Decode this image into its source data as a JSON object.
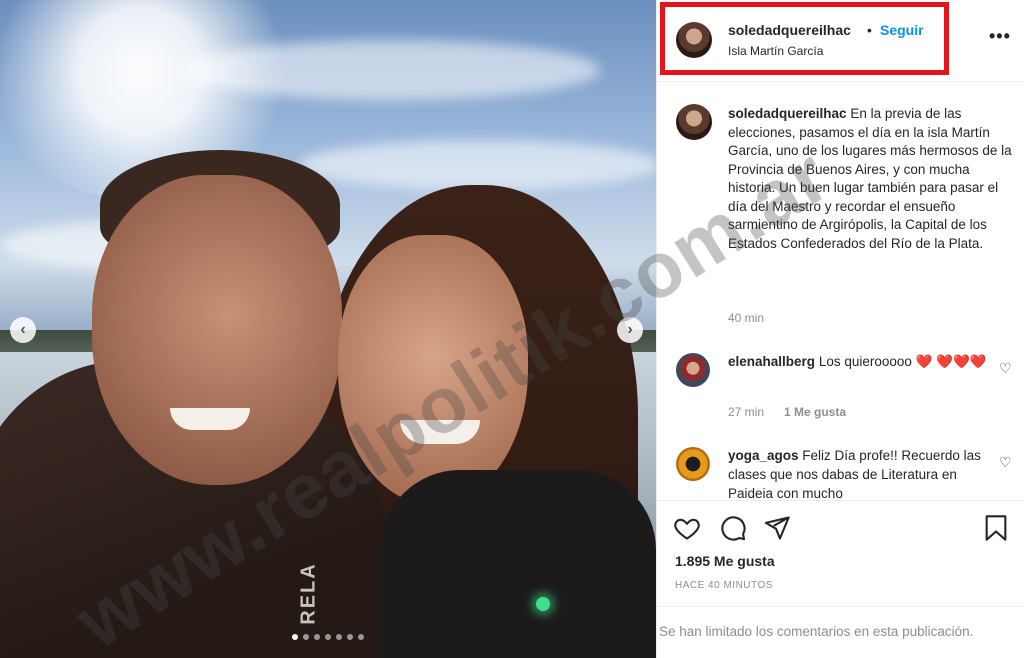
{
  "post": {
    "username": "soledadquereilhac",
    "follow_label": "Seguir",
    "separator": "•",
    "location": "Isla Martín García",
    "more_label": "•••",
    "caption": "En la previa de las elecciones, pasamos el día en la isla Martín García, uno de los lugares más hermosos de la Provincia de Buenos Aires, y con mucha historia. Un buen lugar también para pasar el día del Maestro y recordar el ensueño sarmientino de Argirópolis, la Capital de los Estados Confederados del Río de la Plata.",
    "caption_time": "40 min",
    "likes": "1.895 Me gusta",
    "posted_ago": "HACE 40 MINUTOS",
    "comments_limited": "Se han limitado los comentarios en esta publicación."
  },
  "comments": [
    {
      "username": "elenahallberg",
      "text": "Los quierooooo",
      "emoji": "❤️ ❤️❤️❤️",
      "time": "27 min",
      "likes": "1 Me gusta"
    },
    {
      "username": "yoga_agos",
      "text": "Feliz Día profe!! Recuerdo las clases que nos dabas de Literatura en Paideia con mucho"
    }
  ],
  "photo": {
    "jacket_text": "RELA",
    "carousel_dots": 7,
    "active_dot": 1
  },
  "icons": [
    "heart-icon",
    "comment-icon",
    "share-icon",
    "bookmark-icon",
    "chevron-left-icon",
    "chevron-right-icon",
    "more-icon"
  ],
  "watermark": "www.realpolitik.com.ar",
  "colors": {
    "follow": "#0095f6",
    "highlight_box": "#e4141b",
    "muted": "#8e8e8e"
  }
}
